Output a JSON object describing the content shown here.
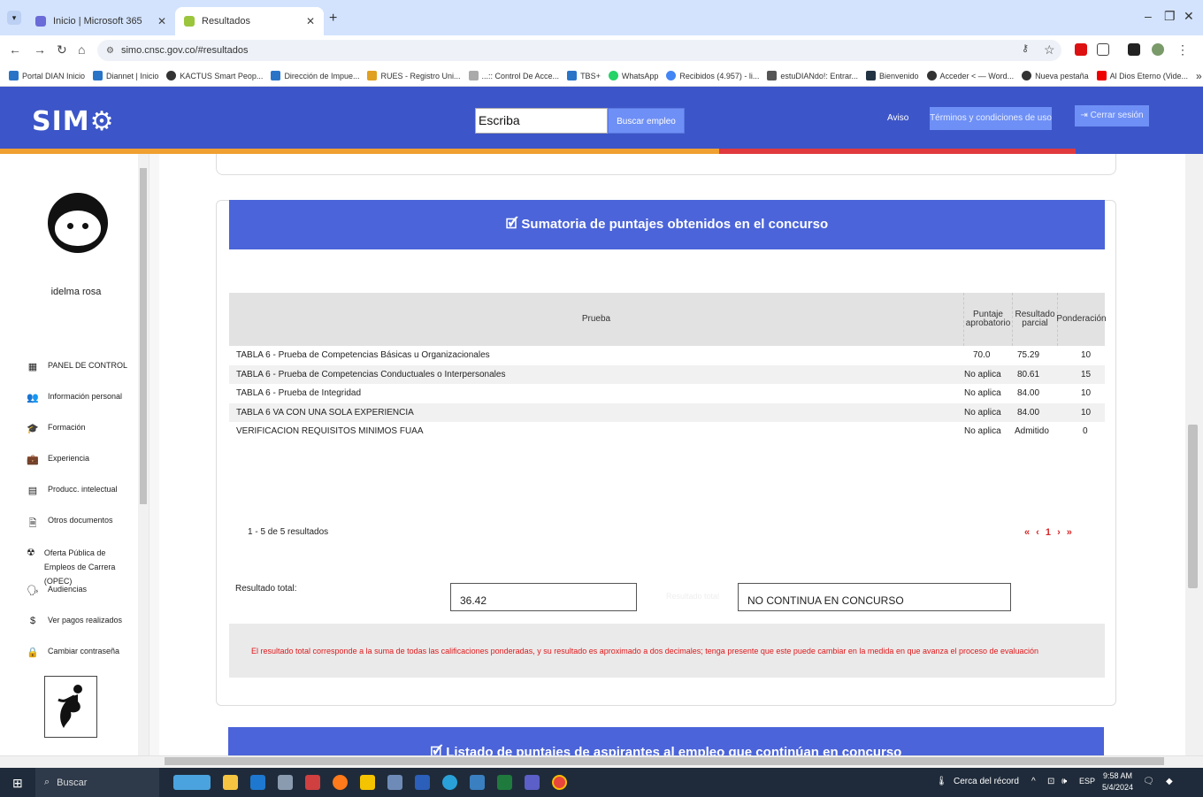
{
  "browser": {
    "tabs": [
      {
        "title": "Inicio | Microsoft 365",
        "active": false
      },
      {
        "title": "Resultados",
        "active": true
      }
    ],
    "url": "simo.cnsc.gov.co/#resultados",
    "bookmarks": [
      "Portal DIAN Inicio",
      "Diannet | Inicio",
      "KACTUS Smart Peop...",
      "Dirección de Impue...",
      "RUES - Registro Uni...",
      "...:: Control De Acce...",
      "TBS+",
      "WhatsApp",
      "Recibidos (4.957) - li...",
      "estuDIANdo!: Entrar...",
      "Bienvenido",
      "Acceder < — Word...",
      "Nueva pestaña",
      "Al Dios Eterno (Vide..."
    ]
  },
  "header": {
    "logo": "SIM",
    "search_value": "Escriba",
    "search_button": "Buscar empleo",
    "aviso": "Aviso",
    "terminos": "Términos y condiciones de uso",
    "cerrar": "Cerrar sesión"
  },
  "sidebar": {
    "username": "idelma rosa",
    "items": [
      {
        "label": "PANEL DE CONTROL",
        "icon": "grid-icon"
      },
      {
        "label": "Información personal",
        "icon": "people-icon"
      },
      {
        "label": "Formación",
        "icon": "graduation-icon"
      },
      {
        "label": "Experiencia",
        "icon": "briefcase-icon"
      },
      {
        "label": "Producc. intelectual",
        "icon": "book-icon"
      },
      {
        "label": "Otros documentos",
        "icon": "document-icon"
      },
      {
        "label": "Oferta Pública de Empleos de Carrera (OPEC)",
        "icon": "radiation-icon"
      },
      {
        "label": "Audiencias",
        "icon": "speaker-icon"
      },
      {
        "label": "Ver pagos realizados",
        "icon": "dollar-icon"
      },
      {
        "label": "Cambiar contraseña",
        "icon": "lock-icon"
      }
    ]
  },
  "results": {
    "title": "Sumatoria de puntajes obtenidos en el concurso",
    "columns": [
      "Prueba",
      "Puntaje aprobatorio",
      "Resultado parcial",
      "Ponderación"
    ],
    "rows": [
      [
        "TABLA 6 - Prueba de Competencias Básicas u Organizacionales",
        "70.0",
        "75.29",
        "10"
      ],
      [
        "TABLA 6 - Prueba de Competencias Conductuales o Interpersonales",
        "No aplica",
        "80.61",
        "15"
      ],
      [
        "TABLA 6 - Prueba de Integridad",
        "No aplica",
        "84.00",
        "10"
      ],
      [
        "TABLA 6 VA CON UNA SOLA EXPERIENCIA",
        "No aplica",
        "84.00",
        "10"
      ],
      [
        "VERIFICACION REQUISITOS MINIMOS FUAA",
        "No aplica",
        "Admitido",
        "0"
      ]
    ],
    "pager_info": "1 - 5 de 5 resultados",
    "pager": "« ‹ 1 › »",
    "total_label": "Resultado total:",
    "total_value": "36.42",
    "ghost_label": "Resultado total",
    "status_value": "NO CONTINUA EN CONCURSO",
    "note": "El resultado total corresponde a la suma de todas las calificaciones ponderadas, y su resultado es aproximado a dos decimales; tenga presente que este puede cambiar en la medida en que avanza el proceso de evaluación",
    "next_section_title": "Listado de puntajes de aspirantes al empleo que continúan en concurso"
  },
  "taskbar": {
    "search": "Buscar",
    "weather": "Cerca del récord",
    "lang": "ESP",
    "time": "9:58 AM",
    "date": "5/4/2024"
  },
  "colors": {
    "header_blue": "#3c55c8",
    "card_header_blue": "#4b64d9",
    "note_red": "#e0181b",
    "stripe_orange": "#f0a030",
    "stripe_red": "#e03a3e",
    "stripe_blue": "#3c55c8"
  }
}
